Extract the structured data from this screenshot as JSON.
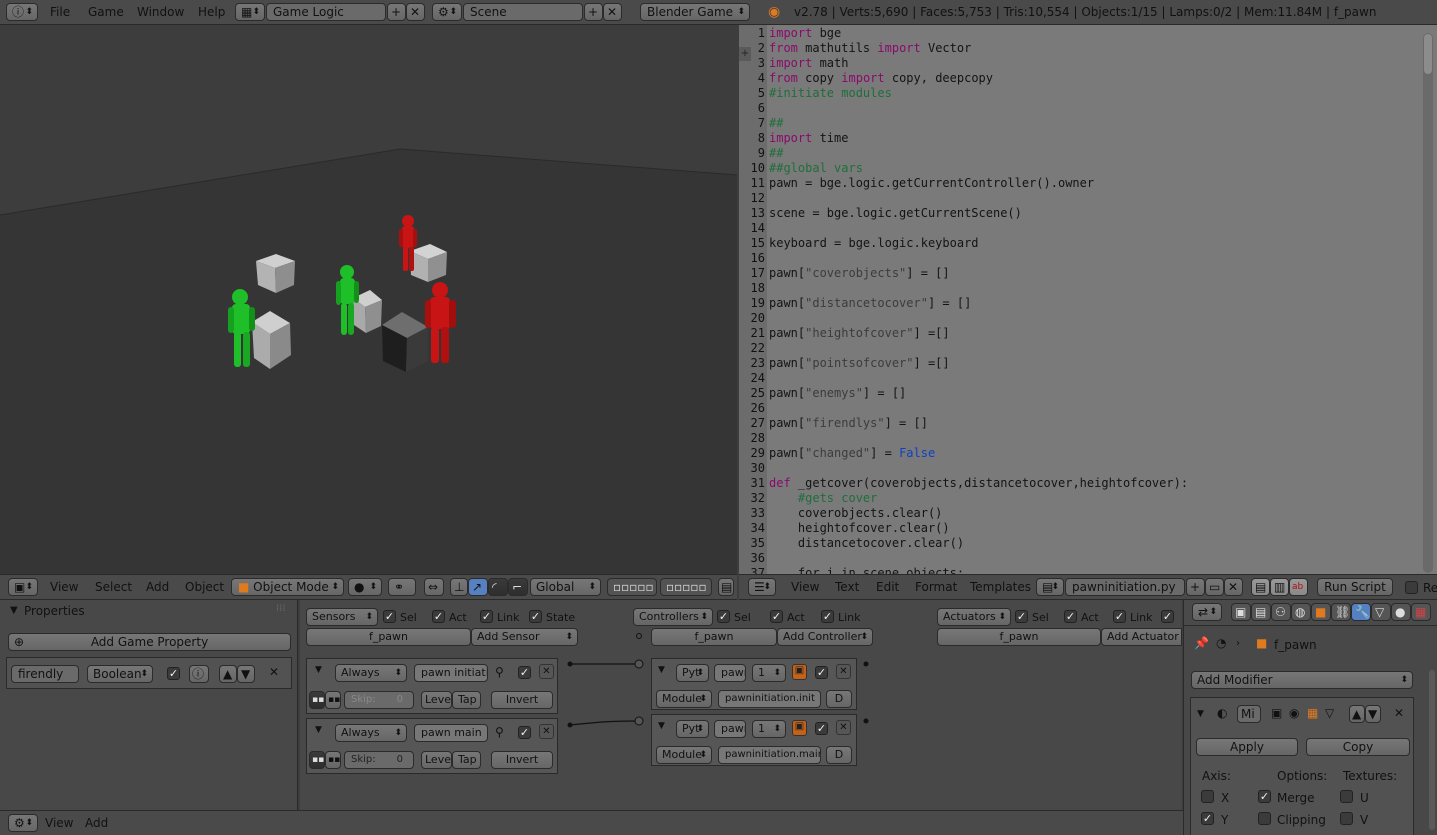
{
  "topbar": {
    "menus": [
      "File",
      "Game",
      "Window",
      "Help"
    ],
    "screen_layout": "Game Logic",
    "scene": "Scene",
    "engine": "Blender Game",
    "stats": "v2.78 | Verts:5,690 | Faces:5,753 | Tris:10,554 | Objects:1/15 | Lamps:0/2 | Mem:11.84M | f_pawn"
  },
  "viewport_header": {
    "menus": [
      "View",
      "Select",
      "Add",
      "Object"
    ],
    "mode": "Object Mode",
    "orientation": "Global"
  },
  "text_editor": {
    "lines": [
      [
        {
          "t": "import",
          "c": "kw"
        },
        {
          "t": " bge",
          "c": "fn"
        }
      ],
      [
        {
          "t": "from",
          "c": "kw"
        },
        {
          "t": " mathutils ",
          "c": "fn"
        },
        {
          "t": "import",
          "c": "kw"
        },
        {
          "t": " Vector",
          "c": "fn"
        }
      ],
      [
        {
          "t": "import",
          "c": "kw"
        },
        {
          "t": " math",
          "c": "fn"
        }
      ],
      [
        {
          "t": "from",
          "c": "kw"
        },
        {
          "t": " copy ",
          "c": "fn"
        },
        {
          "t": "import",
          "c": "kw"
        },
        {
          "t": " copy, deepcopy",
          "c": "fn"
        }
      ],
      [
        {
          "t": "#initiate modules",
          "c": "cm"
        }
      ],
      [],
      [
        {
          "t": "##",
          "c": "cm"
        }
      ],
      [
        {
          "t": "import",
          "c": "kw"
        },
        {
          "t": " time",
          "c": "fn"
        }
      ],
      [
        {
          "t": "##",
          "c": "cm"
        }
      ],
      [
        {
          "t": "##global vars",
          "c": "cm"
        }
      ],
      [
        {
          "t": "pawn = bge.logic.getCurrentController().owner",
          "c": "fn"
        }
      ],
      [],
      [
        {
          "t": "scene = bge.logic.getCurrentScene()",
          "c": "fn"
        }
      ],
      [],
      [
        {
          "t": "keyboard = bge.logic.keyboard",
          "c": "fn"
        }
      ],
      [],
      [
        {
          "t": "pawn[",
          "c": "fn"
        },
        {
          "t": "\"coverobjects\"",
          "c": "st"
        },
        {
          "t": "] = []",
          "c": "fn"
        }
      ],
      [],
      [
        {
          "t": "pawn[",
          "c": "fn"
        },
        {
          "t": "\"distancetocover\"",
          "c": "st"
        },
        {
          "t": "] = []",
          "c": "fn"
        }
      ],
      [],
      [
        {
          "t": "pawn[",
          "c": "fn"
        },
        {
          "t": "\"heightofcover\"",
          "c": "st"
        },
        {
          "t": "] =[]",
          "c": "fn"
        }
      ],
      [],
      [
        {
          "t": "pawn[",
          "c": "fn"
        },
        {
          "t": "\"pointsofcover\"",
          "c": "st"
        },
        {
          "t": "] =[]",
          "c": "fn"
        }
      ],
      [],
      [
        {
          "t": "pawn[",
          "c": "fn"
        },
        {
          "t": "\"enemys\"",
          "c": "st"
        },
        {
          "t": "] = []",
          "c": "fn"
        }
      ],
      [],
      [
        {
          "t": "pawn[",
          "c": "fn"
        },
        {
          "t": "\"firendlys\"",
          "c": "st"
        },
        {
          "t": "] = []",
          "c": "fn"
        }
      ],
      [],
      [
        {
          "t": "pawn[",
          "c": "fn"
        },
        {
          "t": "\"changed\"",
          "c": "st"
        },
        {
          "t": "] = ",
          "c": "fn"
        },
        {
          "t": "False",
          "c": "bl"
        }
      ],
      [],
      [
        {
          "t": "def",
          "c": "kw"
        },
        {
          "t": " _getcover(coverobjects,distancetocover,heightofcover):",
          "c": "fn"
        }
      ],
      [
        {
          "t": "    #gets cover",
          "c": "cm"
        }
      ],
      [
        {
          "t": "    coverobjects.clear()",
          "c": "fn"
        }
      ],
      [
        {
          "t": "    heightofcover.clear()",
          "c": "fn"
        }
      ],
      [
        {
          "t": "    distancetocover.clear()",
          "c": "fn"
        }
      ],
      [],
      [
        {
          "t": "    for i in scene.objects:",
          "c": "fn"
        }
      ]
    ]
  },
  "text_header": {
    "menus": [
      "View",
      "Text",
      "Edit",
      "Format",
      "Templates"
    ],
    "filename": "pawninitiation.py",
    "run_script": "Run Script"
  },
  "properties_panel": {
    "title": "Properties",
    "add_button": "Add Game Property",
    "property_name": "firendly",
    "property_type": "Boolean"
  },
  "logic": {
    "sensors": {
      "title": "Sensors",
      "object": "f_pawn",
      "add": "Add Sensor",
      "filters": [
        "Sel",
        "Act",
        "Link",
        "State"
      ],
      "bricks": [
        {
          "type": "Always",
          "name": "pawn initiation",
          "skip_label": "Skip:",
          "skip": "0",
          "level": "Level",
          "tap": "Tap",
          "invert": "Invert"
        },
        {
          "type": "Always",
          "name": "pawn main",
          "skip_label": "Skip:",
          "skip": "0",
          "level": "Level",
          "tap": "Tap",
          "invert": "Invert"
        }
      ]
    },
    "controllers": {
      "title": "Controllers",
      "object": "f_pawn",
      "add": "Add Controller",
      "filters": [
        "Sel",
        "Act",
        "Link"
      ],
      "bricks": [
        {
          "type": "Pyt",
          "name": "pawn",
          "state": "1",
          "mode": "Module",
          "module": "pawninitiation.init",
          "debug": "D"
        },
        {
          "type": "Pyt",
          "name": "pawn",
          "state": "1",
          "mode": "Module",
          "module": "pawninitiation.main",
          "debug": "D"
        }
      ]
    },
    "actuators": {
      "title": "Actuators",
      "object": "f_pawn",
      "add": "Add Actuator",
      "filters": [
        "Sel",
        "Act",
        "Link"
      ]
    }
  },
  "modifier_panel": {
    "object": "f_pawn",
    "add_modifier": "Add Modifier",
    "modifier_name": "Mi",
    "apply": "Apply",
    "copy": "Copy",
    "axis_label": "Axis:",
    "options_label": "Options:",
    "textures_label": "Textures:",
    "x": "X",
    "y": "Y",
    "merge": "Merge",
    "clipping": "Clipping",
    "u": "U",
    "v": "V"
  },
  "bottom_bar": {
    "menus": [
      "View",
      "Add"
    ]
  },
  "colors": {
    "green_pawn": "#1fbf2a",
    "red_pawn": "#c81414",
    "cube": "#b4b4b4"
  }
}
